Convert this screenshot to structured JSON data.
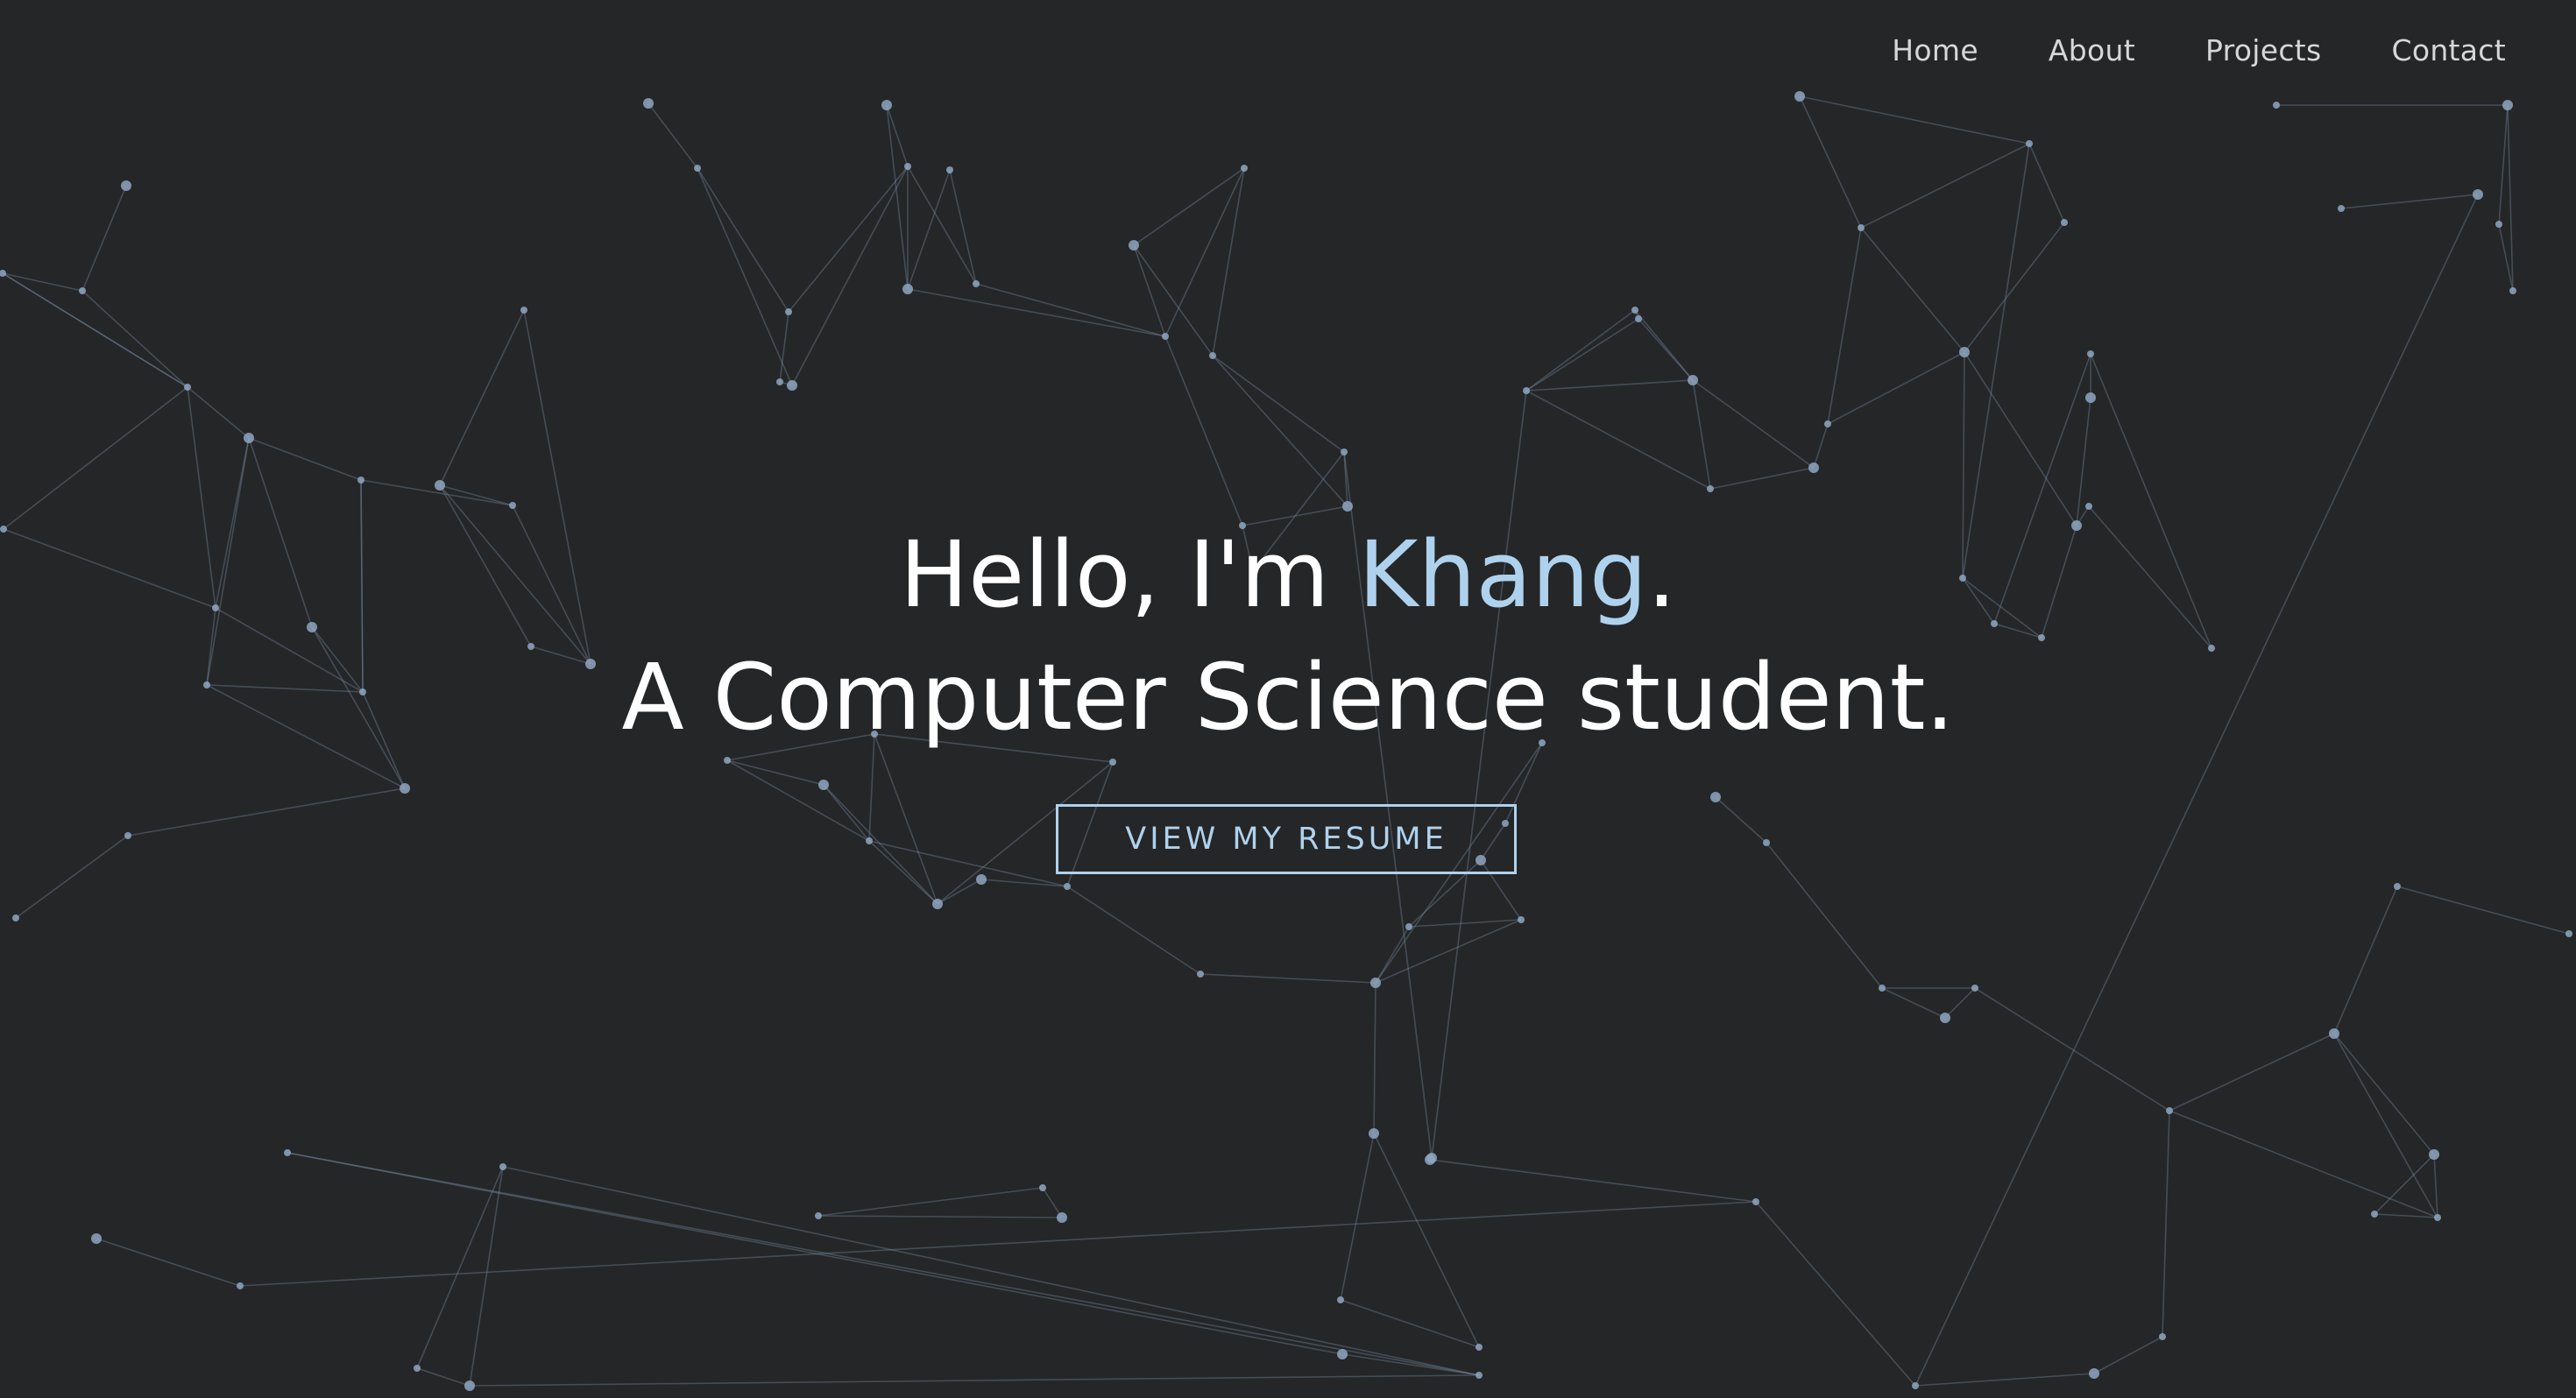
{
  "nav": {
    "items": [
      {
        "label": "Home"
      },
      {
        "label": "About"
      },
      {
        "label": "Projects"
      },
      {
        "label": "Contact"
      }
    ]
  },
  "hero": {
    "greeting_prefix": "Hello, I'm ",
    "name": "Khang",
    "greeting_suffix": ".",
    "subtitle": "A Computer Science student.",
    "button_label": "VIEW MY RESUME"
  },
  "colors": {
    "background": "#252627",
    "accent": "#aed2ee",
    "text": "#ffffff",
    "nav_text": "#d7d7d7",
    "network_line": "#7a8fa6",
    "network_node": "#8ea7c2"
  }
}
